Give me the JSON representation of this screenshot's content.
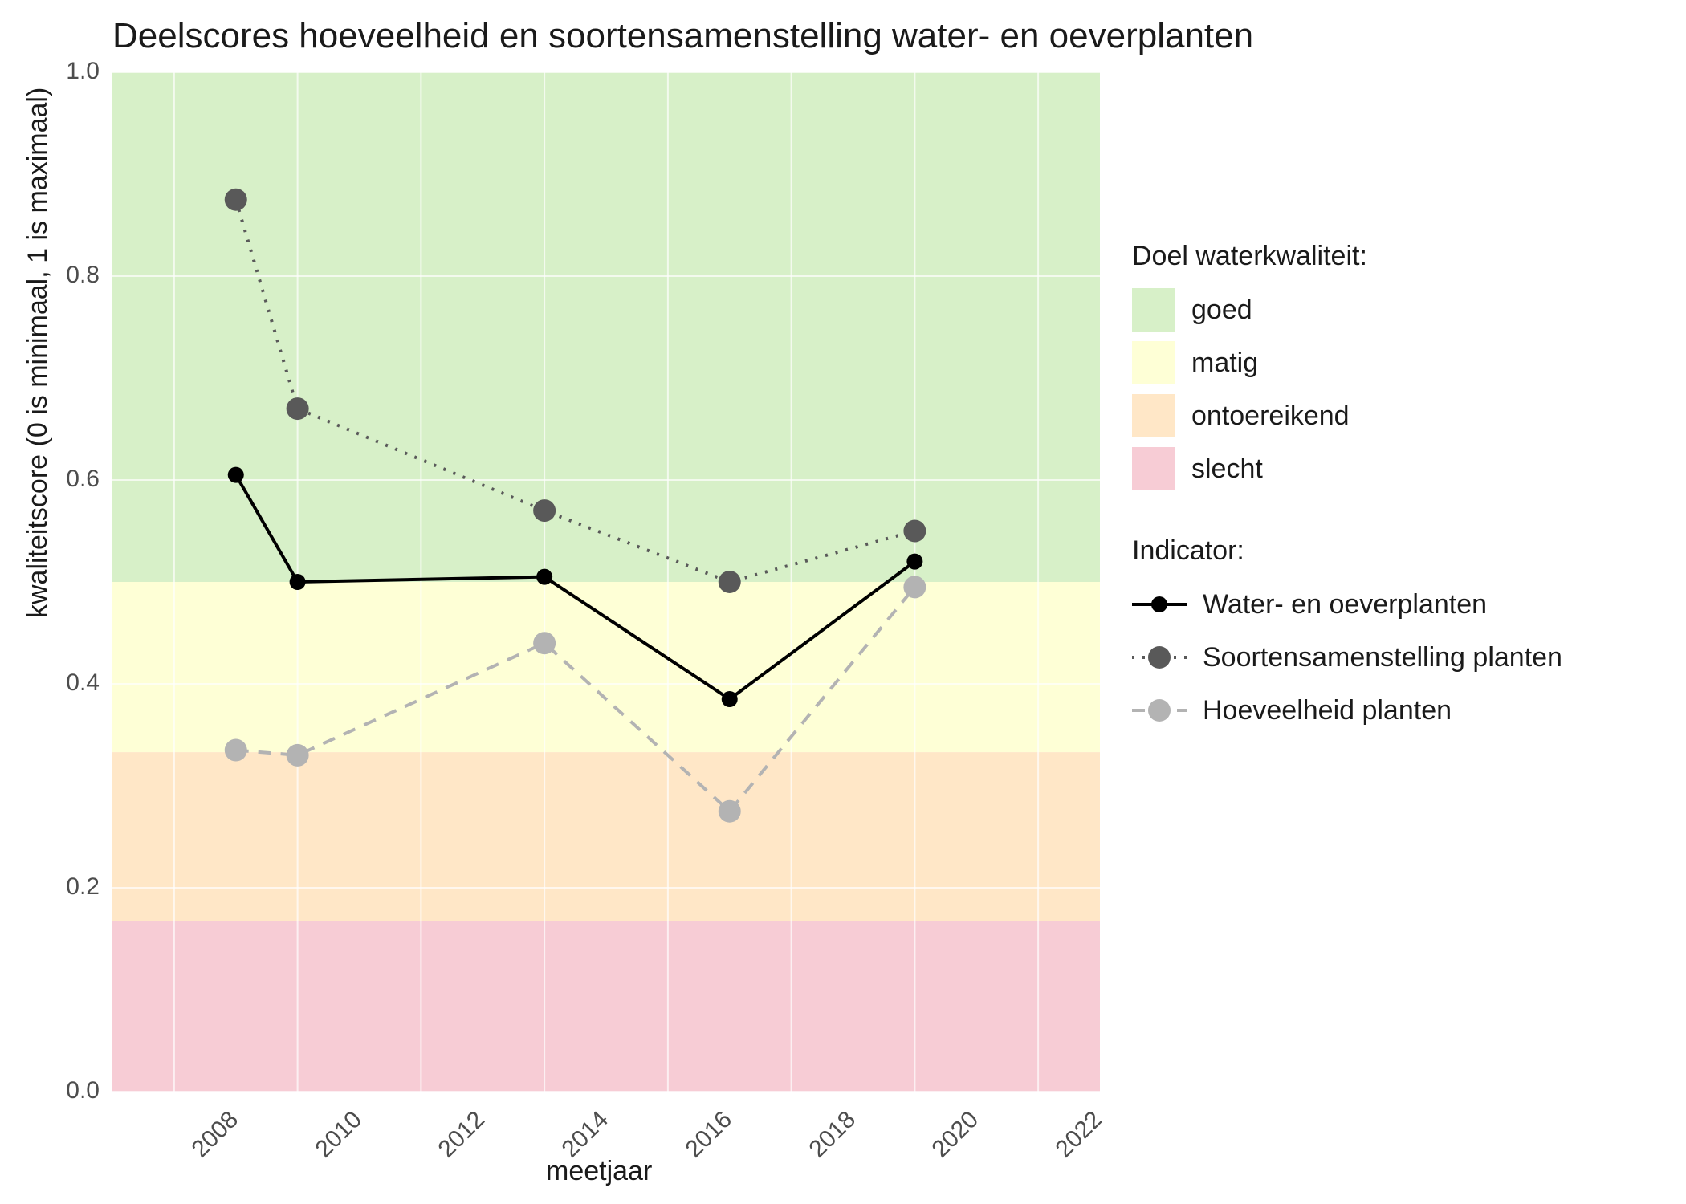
{
  "chart_data": {
    "type": "line",
    "title": "Deelscores hoeveelheid en soortensamenstelling water- en oeverplanten",
    "xlabel": "meetjaar",
    "ylabel": "kwaliteitscore (0 is minimaal, 1 is maximaal)",
    "x_ticks": [
      2008,
      2010,
      2012,
      2014,
      2016,
      2018,
      2020,
      2022
    ],
    "y_ticks": [
      0.0,
      0.2,
      0.4,
      0.6,
      0.8,
      1.0
    ],
    "ylim": [
      0.0,
      1.0
    ],
    "x_range": [
      2007,
      2023
    ],
    "bands": [
      {
        "label": "goed",
        "from": 0.5,
        "to": 1.0,
        "color": "#d7f0c8"
      },
      {
        "label": "matig",
        "from": 0.333,
        "to": 0.5,
        "color": "#feffd6"
      },
      {
        "label": "ontoereikend",
        "from": 0.167,
        "to": 0.333,
        "color": "#ffe7c7"
      },
      {
        "label": "slecht",
        "from": 0.0,
        "to": 0.167,
        "color": "#f7ccd5"
      }
    ],
    "series": [
      {
        "name": "Water- en oeverplanten",
        "color": "#000000",
        "dash": "solid",
        "point_r": 10,
        "x": [
          2009,
          2010,
          2014,
          2017,
          2020
        ],
        "y": [
          0.605,
          0.5,
          0.505,
          0.385,
          0.52
        ]
      },
      {
        "name": "Soortensamenstelling planten",
        "color": "#595959",
        "dash": "dot",
        "point_r": 14,
        "x": [
          2009,
          2010,
          2014,
          2017,
          2020
        ],
        "y": [
          0.875,
          0.67,
          0.57,
          0.5,
          0.55
        ]
      },
      {
        "name": "Hoeveelheid planten",
        "color": "#b3b3b3",
        "dash": "dash",
        "point_r": 14,
        "x": [
          2009,
          2010,
          2014,
          2017,
          2020
        ],
        "y": [
          0.335,
          0.33,
          0.44,
          0.275,
          0.495
        ]
      }
    ],
    "legend_quality_title": "Doel waterkwaliteit:",
    "legend_indicator_title": "Indicator:"
  }
}
